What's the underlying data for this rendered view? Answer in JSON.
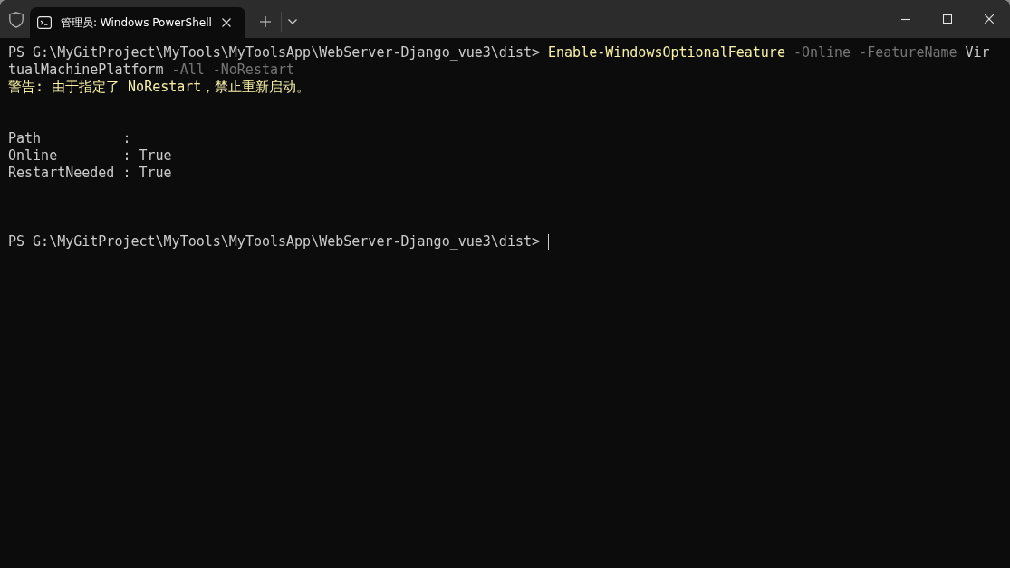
{
  "tabs": [
    {
      "label": "管理员: Windows PowerShell",
      "selected": true
    }
  ],
  "terminal": {
    "lines": [
      {
        "kind": "text",
        "segments": [
          {
            "kind": "prompt",
            "text": "PS G:\\MyGitProject\\MyTools\\MyToolsApp\\WebServer-Django_vue3\\dist>"
          },
          {
            "kind": "command",
            "text": "Enable-WindowsOptionalFeature"
          },
          {
            "kind": "parameter",
            "text": "-Online"
          },
          {
            "kind": "parameter",
            "text": "-FeatureName"
          },
          {
            "kind": "argument",
            "text": "Vir"
          }
        ]
      },
      {
        "kind": "text",
        "segments": [
          {
            "kind": "argument",
            "text": "tualMachinePlatform"
          },
          {
            "kind": "parameter",
            "text": "-All"
          },
          {
            "kind": "parameter",
            "text": "-NoRestart"
          }
        ]
      },
      {
        "kind": "text",
        "segments": [
          {
            "kind": "warning",
            "text": "警告: 由于指定了 NoRestart，禁止重新启动。"
          }
        ]
      },
      {
        "kind": "blank"
      },
      {
        "kind": "blank"
      },
      {
        "kind": "text",
        "segments": [
          {
            "kind": "output",
            "text": "Path          :"
          }
        ]
      },
      {
        "kind": "text",
        "segments": [
          {
            "kind": "output",
            "text": "Online        : True"
          }
        ]
      },
      {
        "kind": "text",
        "segments": [
          {
            "kind": "output",
            "text": "RestartNeeded : True"
          }
        ]
      },
      {
        "kind": "blank"
      },
      {
        "kind": "blank"
      },
      {
        "kind": "blank"
      },
      {
        "kind": "text",
        "segments": [
          {
            "kind": "prompt",
            "text": "PS G:\\MyGitProject\\MyTools\\MyToolsApp\\WebServer-Django_vue3\\dist>"
          }
        ],
        "cursor": true
      }
    ]
  }
}
